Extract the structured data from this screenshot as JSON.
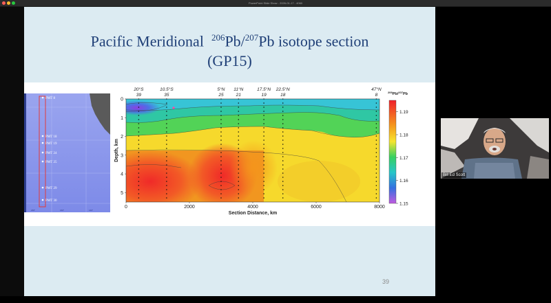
{
  "window": {
    "title": "PowerPoint Slide Show - 2026-01-17 - 4060"
  },
  "slide": {
    "title_line1_part1": "Pacific Meridional",
    "title_sup1": "206",
    "title_mid": "Pb/",
    "title_sup2": "207",
    "title_line1_part2": "Pb isotope section",
    "title_line2": "(GP15)",
    "number": "39"
  },
  "map": {
    "station_labels": [
      "PMT 8",
      "PMT 18",
      "PMT 19",
      "PMT 24",
      "PMT 25",
      "PMT 29",
      "PMT 30"
    ]
  },
  "section_plot": {
    "top_latitudes": [
      "20°S",
      "10.5°S",
      "5°N",
      "11°N",
      "17.5°N",
      "22.5°N",
      "47°N"
    ],
    "top_stations": [
      "39",
      "35",
      "25",
      "21",
      "19",
      "18",
      "8"
    ],
    "x_ticks": [
      "0",
      "2000",
      "4000",
      "6000",
      "8000"
    ],
    "y_ticks": [
      "0",
      "1",
      "2",
      "3",
      "4",
      "5"
    ],
    "x_label": "Section Distance, km",
    "y_label": "Depth, km",
    "colorbar_title_sup1": "206",
    "colorbar_title_mid": "Pb/",
    "colorbar_title_sup2": "207",
    "colorbar_title_end": "Pb",
    "colorbar_ticks": [
      "1.19",
      "1.18",
      "1.17",
      "1.16",
      "1.15"
    ],
    "colors": {
      "high": "#f0202a",
      "orange": "#f59a1d",
      "yellow": "#f6e52f",
      "green": "#37d060",
      "cyan": "#27c6c8",
      "blue": "#3470e0",
      "low": "#c05be0"
    }
  },
  "participant": {
    "name": "Bill Ed Scott"
  }
}
